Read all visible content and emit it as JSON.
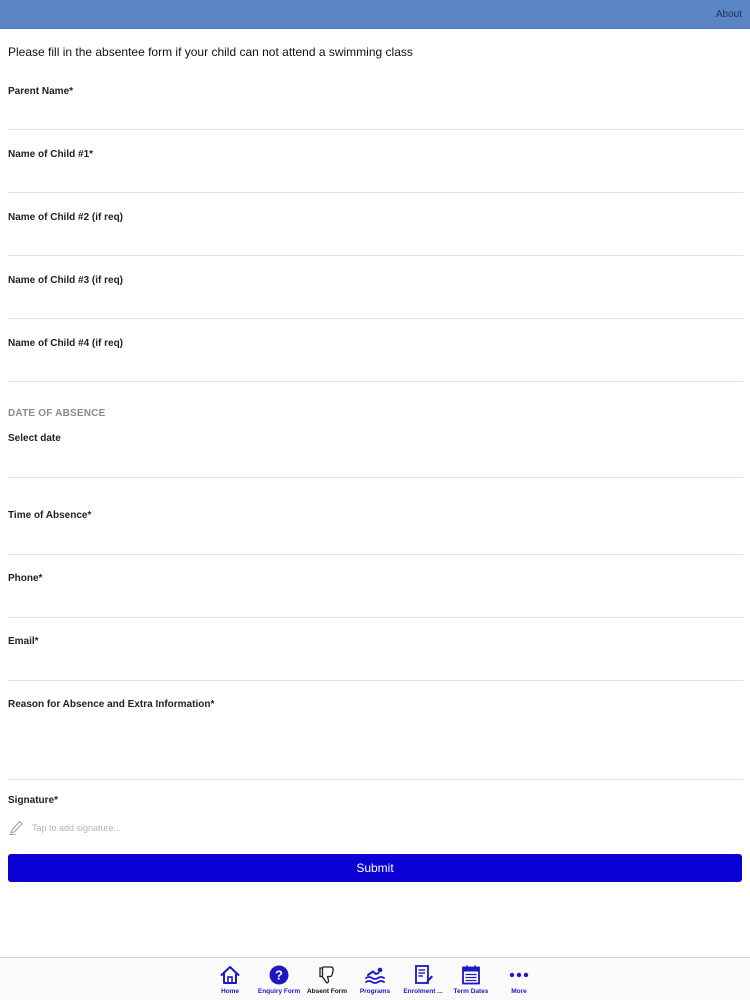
{
  "header": {
    "about_label": "About"
  },
  "intro_text": "Please fill in the absentee form if your child can not attend a swimming class",
  "fields": {
    "parent_name": {
      "label": "Parent Name*",
      "value": ""
    },
    "child1": {
      "label": "Name of Child #1*",
      "value": ""
    },
    "child2": {
      "label": "Name of Child #2 (if req)",
      "value": ""
    },
    "child3": {
      "label": "Name of Child #3 (if req)",
      "value": ""
    },
    "child4": {
      "label": "Name of Child #4 (if req)",
      "value": ""
    },
    "select_date": {
      "label": "Select date",
      "value": ""
    },
    "time_of_absence": {
      "label": "Time of Absence*",
      "value": ""
    },
    "phone": {
      "label": "Phone*",
      "value": ""
    },
    "email": {
      "label": "Email*",
      "value": ""
    },
    "reason": {
      "label": "Reason for Absence and Extra Information*",
      "value": ""
    }
  },
  "section_date_header": "DATE OF ABSENCE",
  "signature": {
    "label": "Signature*",
    "placeholder": "Tap to add signature..."
  },
  "submit_label": "Submit",
  "tabbar": {
    "active": "Absent Form",
    "items": [
      {
        "label": "Home",
        "icon": "home-icon"
      },
      {
        "label": "Enquiry Form",
        "icon": "question-icon"
      },
      {
        "label": "Absent Form",
        "icon": "thumbs-down-icon"
      },
      {
        "label": "Programs",
        "icon": "swimmer-icon"
      },
      {
        "label": "Enrolment ...",
        "icon": "form-icon"
      },
      {
        "label": "Term Dates",
        "icon": "calendar-icon"
      },
      {
        "label": "More",
        "icon": "more-icon"
      }
    ]
  },
  "colors": {
    "header_bar": "#5a86c5",
    "submit_button": "#0b00d4",
    "tab_accent": "#1d18c4"
  }
}
